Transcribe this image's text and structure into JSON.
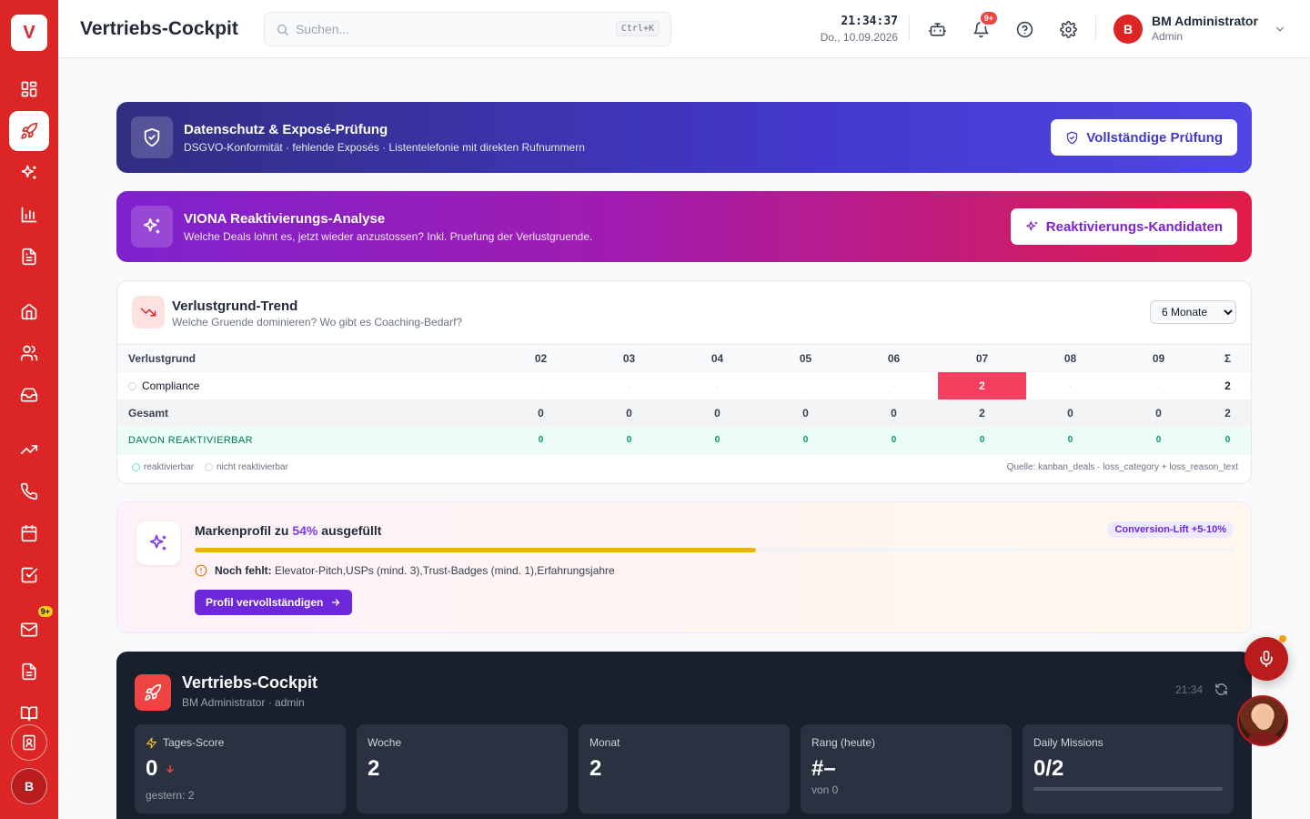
{
  "sidebar": {
    "logo": "V",
    "mail_badge": "9+",
    "avatar": "B"
  },
  "header": {
    "title": "Vertriebs-Cockpit",
    "search_placeholder": "Suchen...",
    "search_shortcut": "Ctrl+K",
    "time": "21:34:37",
    "date": "Do., 10.09.2026",
    "notification_badge": "9+",
    "user": {
      "initial": "B",
      "name": "BM Administrator",
      "role": "Admin"
    }
  },
  "banners": {
    "privacy": {
      "title": "Datenschutz & Exposé-Prüfung",
      "subtitle": "DSGVO-Konformität · fehlende Exposés · Listentelefonie mit direkten Rufnummern",
      "button": "Vollständige Prüfung"
    },
    "reactivation": {
      "title": "VIONA Reaktivierungs-Analyse",
      "subtitle": "Welche Deals lohnt es, jetzt wieder anzustossen? Inkl. Pruefung der Verlustgruende.",
      "button": "Reaktivierungs-Kandidaten"
    }
  },
  "trend": {
    "title": "Verlustgrund-Trend",
    "subtitle": "Welche Gruende dominieren? Wo gibt es Coaching-Bedarf?",
    "range": "6 Monate",
    "range_options": [
      "6 Monate"
    ],
    "columns": [
      "Verlustgrund",
      "02",
      "03",
      "04",
      "05",
      "06",
      "07",
      "08",
      "09",
      "Σ"
    ],
    "rows": [
      {
        "label": "Compliance",
        "values": [
          "·",
          "·",
          "·",
          "·",
          "·",
          "2",
          "·",
          "·"
        ],
        "sum": "2"
      }
    ],
    "total": {
      "label": "Gesamt",
      "values": [
        "0",
        "0",
        "0",
        "0",
        "0",
        "2",
        "0",
        "0"
      ],
      "sum": "2"
    },
    "reactivatable": {
      "label": "DAVON REAKTIVIERBAR",
      "values": [
        "0",
        "0",
        "0",
        "0",
        "0",
        "0",
        "0",
        "0"
      ],
      "sum": "0"
    },
    "legend": [
      "reaktivierbar",
      "nicht reaktivierbar"
    ],
    "source": "Quelle: kanban_deals · loss_category + loss_reason_text"
  },
  "profile": {
    "title_prefix": "Markenprofil zu ",
    "percent_label": "54%",
    "title_suffix": " ausgefüllt",
    "progress": 0.54,
    "badge": "Conversion-Lift +5-10%",
    "missing_label": "Noch fehlt:",
    "missing_text": "Elevator-Pitch,USPs (mind. 3),Trust-Badges (mind. 1),Erfahrungsjahre",
    "button": "Profil vervollständigen"
  },
  "cockpit": {
    "title": "Vertriebs-Cockpit",
    "subtitle": "BM Administrator · admin",
    "time": "21:34",
    "stats": [
      {
        "label": "Tages-Score",
        "value": "0",
        "note": "gestern: 2"
      },
      {
        "label": "Woche",
        "value": "2"
      },
      {
        "label": "Monat",
        "value": "2"
      },
      {
        "label": "Rang (heute)",
        "value": "#–",
        "note": "von 0"
      },
      {
        "label": "Daily Missions",
        "value": "0/2",
        "progress": 0
      }
    ]
  },
  "colors": {
    "sidebar": "#dc2626",
    "hot_cell": "#f43f5e",
    "profile_accent": "#7c3aed",
    "progress_fill": "#eab308"
  }
}
